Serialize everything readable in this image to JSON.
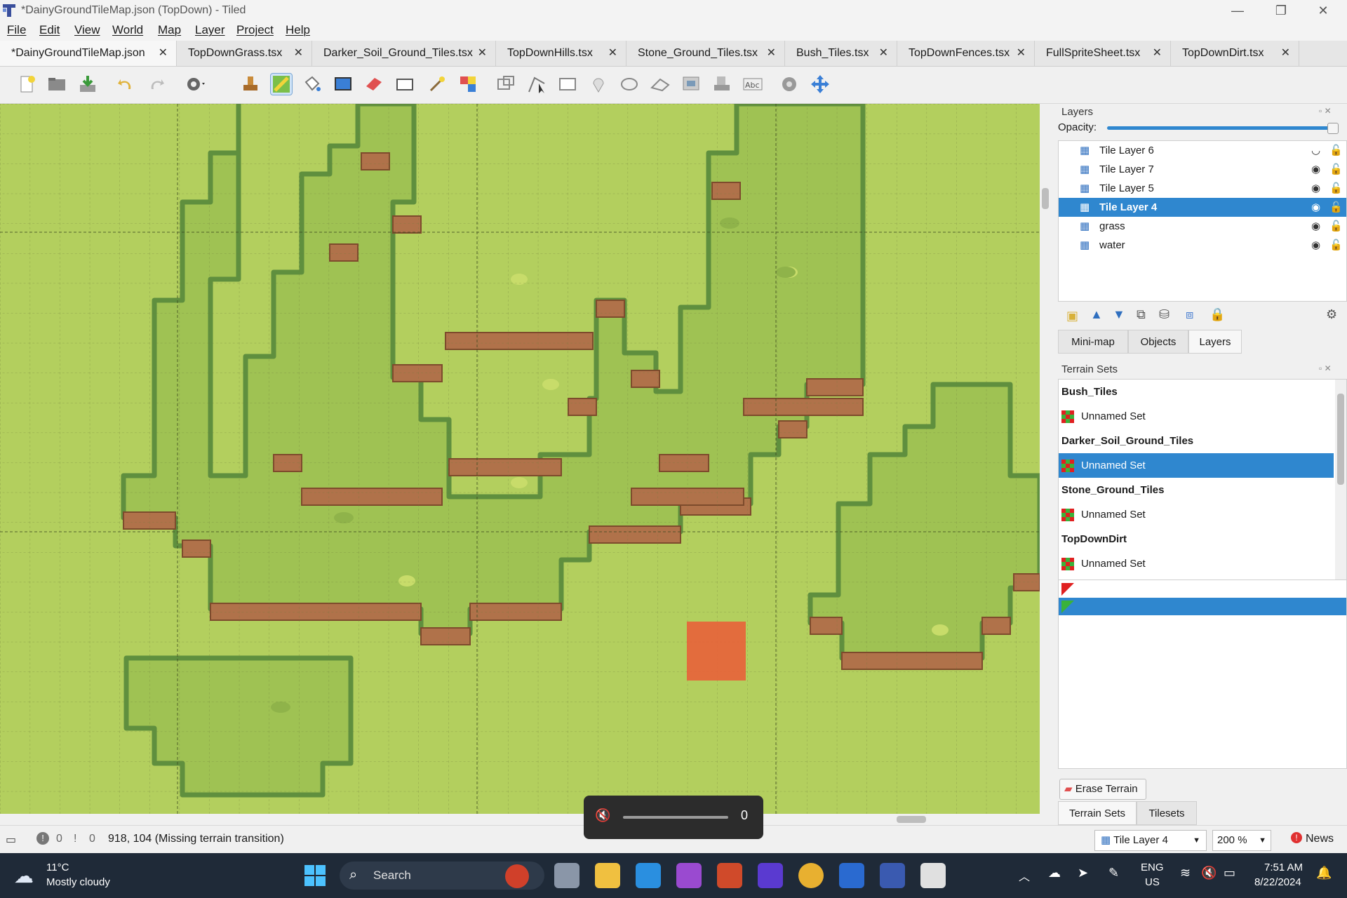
{
  "window": {
    "title": "*DainyGroundTileMap.json (TopDown) - Tiled",
    "minimize": "—",
    "restore": "❐",
    "close": "✕"
  },
  "menu": [
    "File",
    "Edit",
    "View",
    "World",
    "Map",
    "Layer",
    "Project",
    "Help"
  ],
  "tabs": [
    {
      "label": "*DainyGroundTileMap.json",
      "active": true
    },
    {
      "label": "TopDownGrass.tsx"
    },
    {
      "label": "Darker_Soil_Ground_Tiles.tsx"
    },
    {
      "label": "TopDownHills.tsx"
    },
    {
      "label": "Stone_Ground_Tiles.tsx"
    },
    {
      "label": "Bush_Tiles.tsx"
    },
    {
      "label": "TopDownFences.tsx"
    },
    {
      "label": "FullSpriteSheet.tsx"
    },
    {
      "label": "TopDownDirt.tsx"
    }
  ],
  "tab_close": "✕",
  "layers_panel": {
    "title": "Layers",
    "opacity_label": "Opacity:",
    "opacity": 1.0,
    "layers": [
      {
        "name": "Tile Layer 6",
        "visible": false
      },
      {
        "name": "Tile Layer 7",
        "visible": true
      },
      {
        "name": "Tile Layer 5",
        "visible": true
      },
      {
        "name": "Tile Layer 4",
        "visible": true,
        "selected": true
      },
      {
        "name": "grass",
        "visible": true
      },
      {
        "name": "water",
        "visible": true
      }
    ]
  },
  "panel_tabs": [
    {
      "label": "Mini-map"
    },
    {
      "label": "Objects"
    },
    {
      "label": "Layers",
      "active": true
    }
  ],
  "terrain_panel": {
    "title": "Terrain Sets",
    "sets": [
      {
        "tileset": "Bush_Tiles",
        "name": "Unnamed Set"
      },
      {
        "tileset": "Darker_Soil_Ground_Tiles",
        "name": "Unnamed Set",
        "selected": true
      },
      {
        "tileset": "Stone_Ground_Tiles",
        "name": "Unnamed Set"
      },
      {
        "tileset": "TopDownDirt",
        "name": "Unnamed Set"
      }
    ],
    "erase_label": "Erase Terrain"
  },
  "bottom_tabs": [
    {
      "label": "Terrain Sets",
      "active": true
    },
    {
      "label": "Tilesets"
    }
  ],
  "status": {
    "errors": "0",
    "warnings": "0",
    "coords": "918, 104 (Missing terrain transition)",
    "current_layer": "Tile Layer 4",
    "zoom": "200 %",
    "news": "News"
  },
  "volume": {
    "level": "0",
    "fraction": 0
  },
  "taskbar": {
    "temp": "11°C",
    "weather": "Mostly cloudy",
    "search": "Search",
    "lang1": "ENG",
    "lang2": "US",
    "time": "7:51 AM",
    "date": "8/22/2024"
  }
}
